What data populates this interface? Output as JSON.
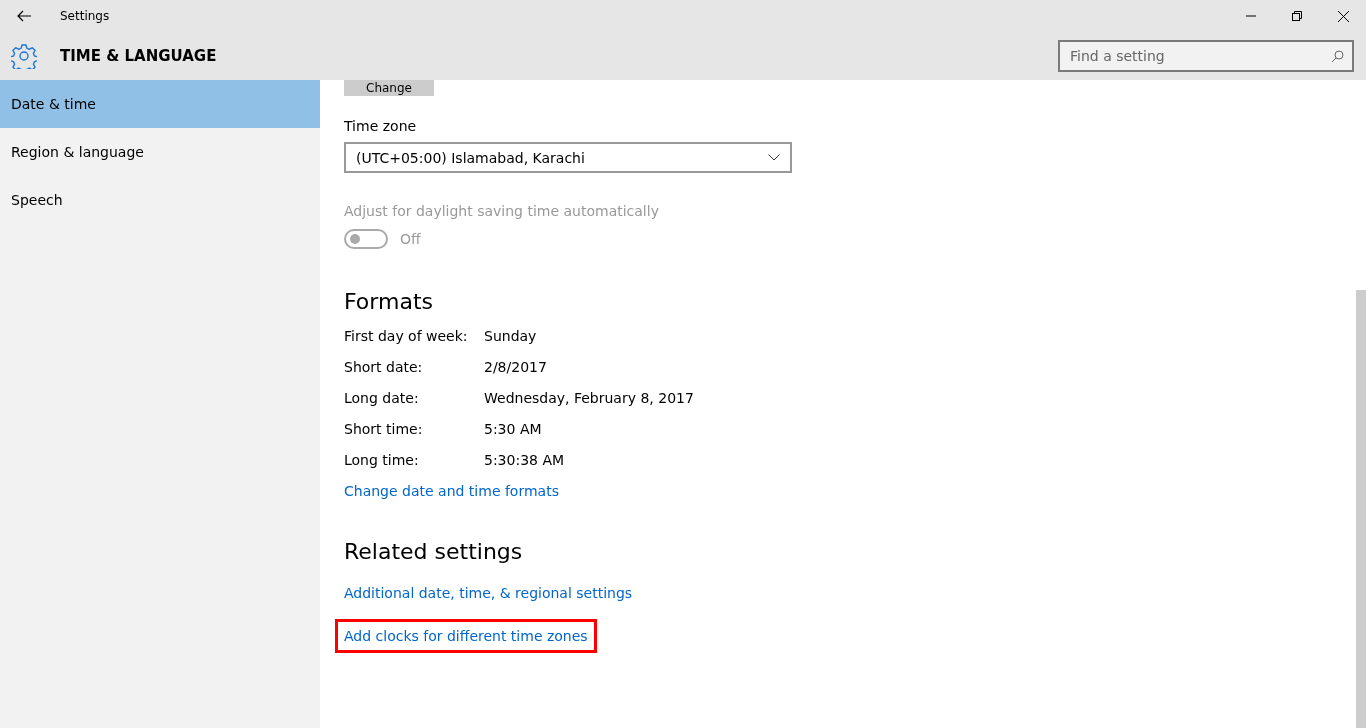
{
  "window": {
    "title": "Settings"
  },
  "header": {
    "title": "TIME & LANGUAGE"
  },
  "search": {
    "placeholder": "Find a setting"
  },
  "sidebar": {
    "items": [
      {
        "label": "Date & time",
        "selected": true
      },
      {
        "label": "Region & language",
        "selected": false
      },
      {
        "label": "Speech",
        "selected": false
      }
    ]
  },
  "change_button": "Change",
  "time_zone": {
    "label": "Time zone",
    "value": "(UTC+05:00) Islamabad, Karachi"
  },
  "daylight": {
    "label": "Adjust for daylight saving time automatically",
    "on": false,
    "disabled": true,
    "state_text": "Off"
  },
  "formats": {
    "heading": "Formats",
    "rows": [
      {
        "label": "First day of week:",
        "value": "Sunday"
      },
      {
        "label": "Short date:",
        "value": "2/8/2017"
      },
      {
        "label": "Long date:",
        "value": "Wednesday, February 8, 2017"
      },
      {
        "label": "Short time:",
        "value": "5:30 AM"
      },
      {
        "label": "Long time:",
        "value": "5:30:38 AM"
      }
    ],
    "link": "Change date and time formats"
  },
  "related": {
    "heading": "Related settings",
    "links": [
      {
        "label": "Additional date, time, & regional settings",
        "highlighted": false
      },
      {
        "label": "Add clocks for different time zones",
        "highlighted": true
      }
    ]
  }
}
